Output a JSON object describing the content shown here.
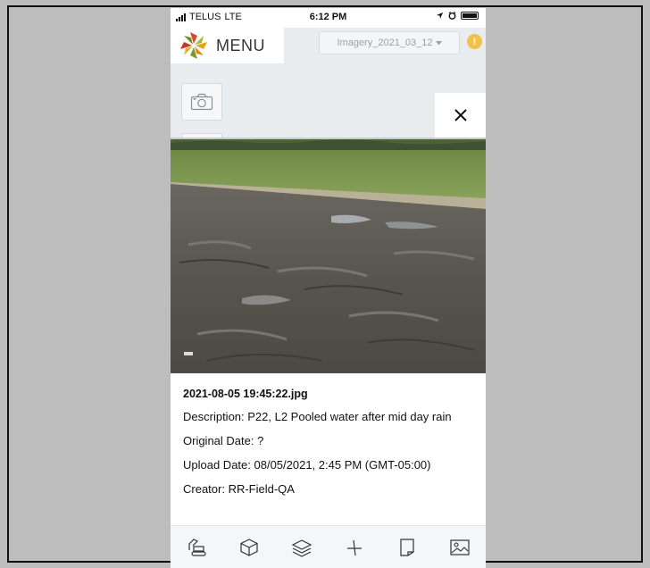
{
  "status_bar": {
    "carrier": "TELUS",
    "network": "LTE",
    "time": "6:12 PM"
  },
  "header": {
    "menu_label": "MENU",
    "imagery_selected": "Imagery_2021_03_12",
    "alert_symbol": "!"
  },
  "photo_viewer": {
    "close_symbol": "×",
    "filename": "2021-08-05 19:45:22.jpg",
    "description": "Description: P22, L2 Pooled water after mid day rain",
    "original_date": "Original Date: ?",
    "upload_date": "Upload Date: 08/05/2021, 2:45 PM (GMT-05:00)",
    "creator": "Creator: RR-Field-QA"
  },
  "toolbar_icons": [
    "excavator-icon",
    "cube-icon",
    "layers-icon",
    "measure-icon",
    "note-icon",
    "image-icon"
  ],
  "colors": {
    "alert": "#f0c14b",
    "background_outer": "#bdbdbd",
    "panel": "#ffffff"
  }
}
